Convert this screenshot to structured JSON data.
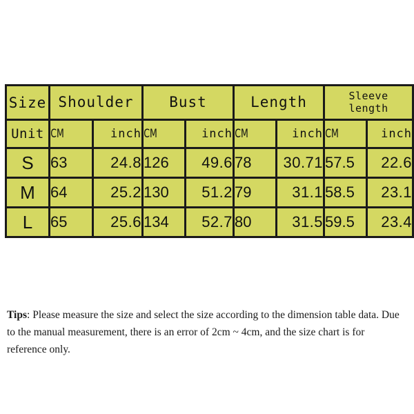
{
  "table": {
    "size_header": "Size",
    "unit_header": "Unit",
    "unit_cm": "CM",
    "unit_inch": "inch",
    "measurements": [
      {
        "label": "Shoulder",
        "wrap": false
      },
      {
        "label": "Bust",
        "wrap": false
      },
      {
        "label": "Length",
        "wrap": false
      },
      {
        "label": "Sleeve length",
        "wrap": true,
        "line1": "Sleeve",
        "line2": "length"
      }
    ],
    "rows": [
      {
        "size": "S",
        "shoulder_cm": "63",
        "shoulder_in": "24.8",
        "bust_cm": "126",
        "bust_in": "49.6",
        "length_cm": "78",
        "length_in": "30.71",
        "sleeve_cm": "57.5",
        "sleeve_in": "22.6"
      },
      {
        "size": "M",
        "shoulder_cm": "64",
        "shoulder_in": "25.2",
        "bust_cm": "130",
        "bust_in": "51.2",
        "length_cm": "79",
        "length_in": "31.1",
        "sleeve_cm": "58.5",
        "sleeve_in": "23.1"
      },
      {
        "size": "L",
        "shoulder_cm": "65",
        "shoulder_in": "25.6",
        "bust_cm": "134",
        "bust_in": "52.7",
        "length_cm": "80",
        "length_in": "31.5",
        "sleeve_cm": "59.5",
        "sleeve_in": "23.4"
      }
    ]
  },
  "tips": {
    "lead": "Tips",
    "body": ": Please measure the size and select the size according to the dimension table data. Due to the manual measurement, there is an error of 2cm ~ 4cm, and the size chart is for reference only."
  },
  "colors": {
    "cell_background": "#d4d862",
    "border": "#1a1a1a",
    "page_background": "#ffffff",
    "text": "#111111"
  },
  "chart_data": {
    "type": "table",
    "title": "Size Chart",
    "columns": [
      "Size",
      "Shoulder CM",
      "Shoulder inch",
      "Bust CM",
      "Bust inch",
      "Length CM",
      "Length inch",
      "Sleeve length CM",
      "Sleeve length inch"
    ],
    "rows": [
      [
        "S",
        63,
        24.8,
        126,
        49.6,
        78,
        30.71,
        57.5,
        22.6
      ],
      [
        "M",
        64,
        25.2,
        130,
        51.2,
        79,
        31.1,
        58.5,
        23.1
      ],
      [
        "L",
        65,
        25.6,
        134,
        52.7,
        80,
        31.5,
        59.5,
        23.4
      ]
    ]
  }
}
